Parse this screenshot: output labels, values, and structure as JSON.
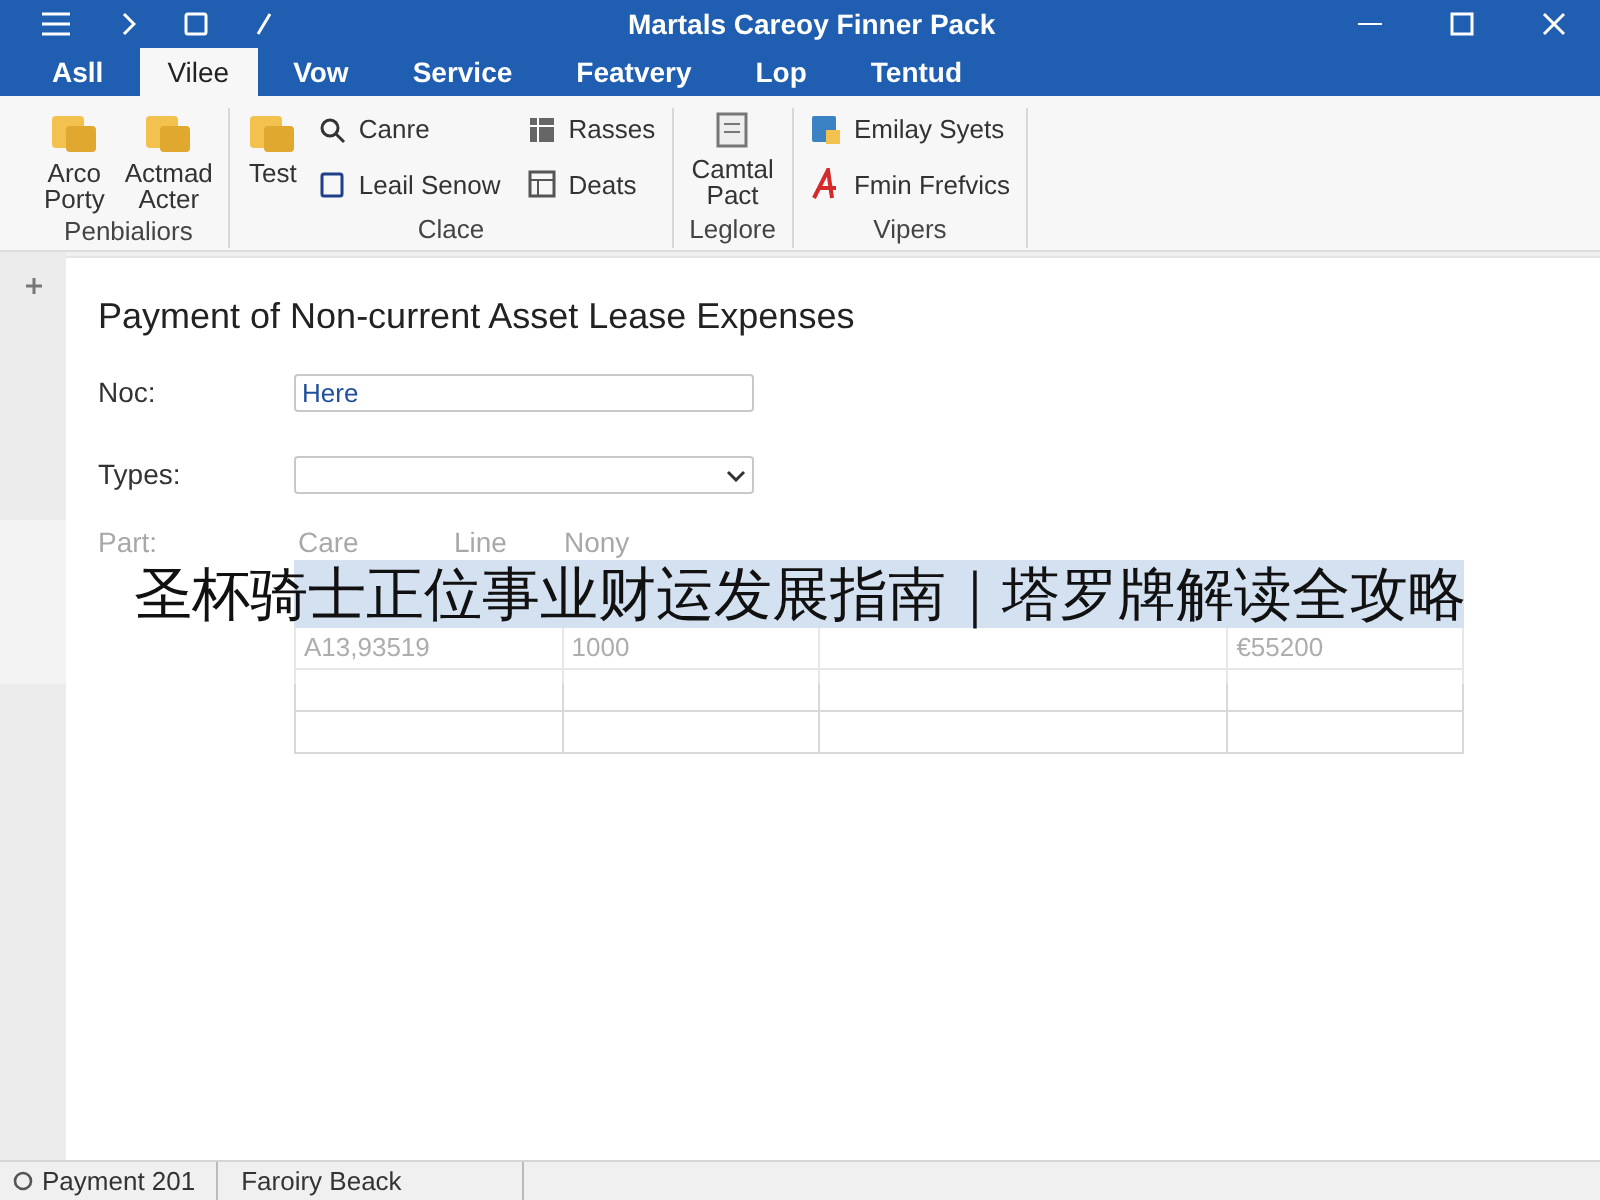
{
  "window": {
    "title": "Martals Careoy Finner Pack"
  },
  "tabs": [
    {
      "label": "Asll",
      "selected": false
    },
    {
      "label": "Vilee",
      "selected": true
    },
    {
      "label": "Vow",
      "selected": false
    },
    {
      "label": "Service",
      "selected": false
    },
    {
      "label": "Featvery",
      "selected": false
    },
    {
      "label": "Lop",
      "selected": false
    },
    {
      "label": "Tentud",
      "selected": false
    }
  ],
  "ribbon": {
    "groups": [
      {
        "label": "Penbialiors",
        "large": [
          "Arco\nPorty",
          "Actmad\nActer"
        ]
      },
      {
        "label": "Clace",
        "large": [
          "Test"
        ],
        "small": [
          "Canre",
          "Leail Senow",
          "Rasses",
          "Deats"
        ]
      },
      {
        "label": "Leglore",
        "large": [
          "Camtal\nPact"
        ]
      },
      {
        "label": "Vipers",
        "small": [
          "Emilay Syets",
          "Fmin Frefvics"
        ]
      }
    ]
  },
  "form": {
    "title": "Payment of Non-current Asset Lease Expenses",
    "fields": [
      {
        "kind": "text",
        "label": "Noc:",
        "value": "Here"
      },
      {
        "kind": "select",
        "label": "Types:"
      }
    ],
    "table_labels": [
      "Part:",
      "Care",
      "Line",
      "Nony"
    ],
    "rows": [
      [
        "A13,93519",
        "1000",
        "",
        "€55200"
      ],
      [
        "",
        "",
        "",
        ""
      ],
      [
        "",
        "",
        "",
        ""
      ]
    ]
  },
  "banner": {
    "text": "圣杯骑士正位事业财运发展指南｜塔罗牌解读全攻略"
  },
  "status_bar": [
    "Payment 201",
    "Faroiry Beack"
  ]
}
